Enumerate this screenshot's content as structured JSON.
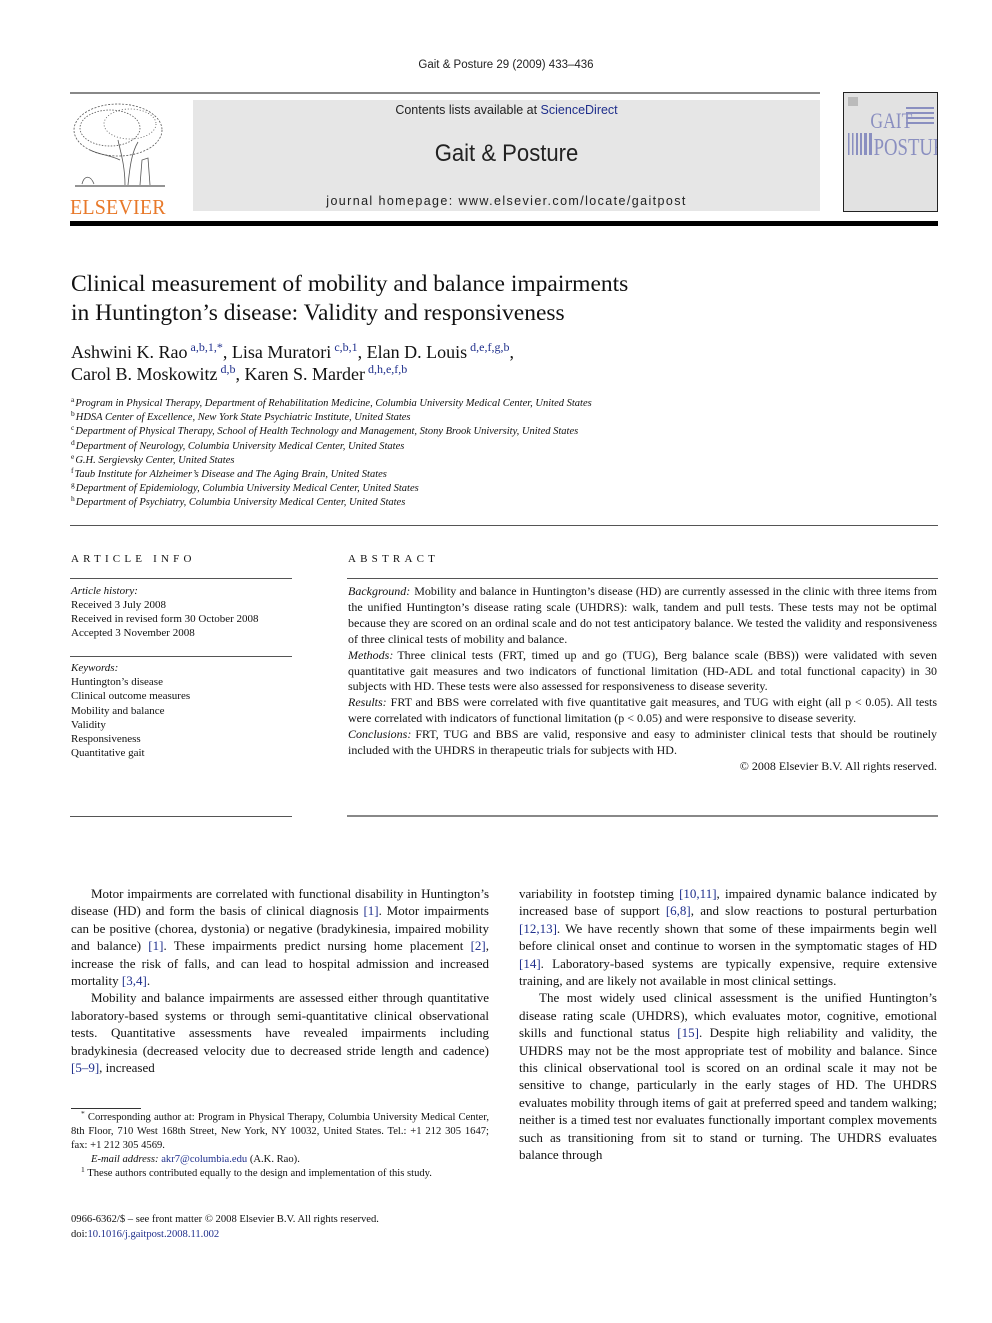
{
  "header": {
    "journal_ref": "Gait & Posture 29 (2009) 433–436",
    "contents_prefix": "Contents lists available at ",
    "contents_link": "ScienceDirect",
    "journal_name": "Gait & Posture",
    "homepage": "journal homepage: www.elsevier.com/locate/gaitpost",
    "publisher_logo_text": "ELSEVIER",
    "cover_title_line1": "GAIT",
    "cover_title_line2": "POSTURE",
    "colors": {
      "publisher_orange": "#e8792a",
      "link_blue": "#1f2f8c",
      "banner_gray": "#e6e6e6"
    }
  },
  "article": {
    "title_line1": "Clinical measurement of mobility and balance impairments",
    "title_line2": "in Huntington’s disease: Validity and responsiveness",
    "authors": [
      {
        "name": "Ashwini K. Rao",
        "sup": "a,b,1,*",
        "sep": ", "
      },
      {
        "name": "Lisa Muratori",
        "sup": "c,b,1",
        "sep": ", "
      },
      {
        "name": "Elan D. Louis",
        "sup": "d,e,f,g,b",
        "sep": ","
      },
      {
        "name": "Carol B. Moskowitz",
        "sup": "d,b",
        "sep": ", "
      },
      {
        "name": "Karen S. Marder",
        "sup": "d,h,e,f,b",
        "sep": ""
      }
    ],
    "affiliations": [
      {
        "key": "a",
        "text": "Program in Physical Therapy, Department of Rehabilitation Medicine, Columbia University Medical Center, United States"
      },
      {
        "key": "b",
        "text": "HDSA Center of Excellence, New York State Psychiatric Institute, United States"
      },
      {
        "key": "c",
        "text": "Department of Physical Therapy, School of Health Technology and Management, Stony Brook University, United States"
      },
      {
        "key": "d",
        "text": "Department of Neurology, Columbia University Medical Center, United States"
      },
      {
        "key": "e",
        "text": "G.H. Sergievsky Center, United States"
      },
      {
        "key": "f",
        "text": "Taub Institute for Alzheimer’s Disease and The Aging Brain, United States"
      },
      {
        "key": "g",
        "text": "Department of Epidemiology, Columbia University Medical Center, United States"
      },
      {
        "key": "h",
        "text": "Department of Psychiatry, Columbia University Medical Center, United States"
      }
    ]
  },
  "article_info": {
    "heading": "ARTICLE INFO",
    "history_label": "Article history:",
    "history": [
      "Received 3 July 2008",
      "Received in revised form 30 October 2008",
      "Accepted 3 November 2008"
    ],
    "keywords_label": "Keywords:",
    "keywords": [
      "Huntington’s disease",
      "Clinical outcome measures",
      "Mobility and balance",
      "Validity",
      "Responsiveness",
      "Quantitative gait"
    ]
  },
  "abstract": {
    "heading": "ABSTRACT",
    "sections": [
      {
        "label": "Background:",
        "text": "Mobility and balance in Huntington’s disease (HD) are currently assessed in the clinic with three items from the unified Huntington’s disease rating scale (UHDRS): walk, tandem and pull tests. These tests may not be optimal because they are scored on an ordinal scale and do not test anticipatory balance. We tested the validity and responsiveness of three clinical tests of mobility and balance."
      },
      {
        "label": "Methods:",
        "text": "Three clinical tests (FRT, timed up and go (TUG), Berg balance scale (BBS)) were validated with seven quantitative gait measures and two indicators of functional limitation (HD-ADL and total functional capacity) in 30 subjects with HD. These tests were also assessed for responsiveness to disease severity."
      },
      {
        "label": "Results:",
        "text": "FRT and BBS were correlated with five quantitative gait measures, and TUG with eight (all p < 0.05). All tests were correlated with indicators of functional limitation (p < 0.05) and were responsive to disease severity."
      },
      {
        "label": "Conclusions:",
        "text": "FRT, TUG and BBS are valid, responsive and easy to administer clinical tests that should be routinely included with the UHDRS in therapeutic trials for subjects with HD."
      }
    ],
    "copyright": "© 2008 Elsevier B.V. All rights reserved."
  },
  "body": {
    "left": [
      [
        {
          "t": "Motor impairments are correlated with functional disability in Huntington’s disease (HD) and form the basis of clinical diagnosis "
        },
        {
          "ref": "[1]"
        },
        {
          "t": ". Motor impairments can be positive (chorea, dystonia) or negative (bradykinesia, impaired mobility and balance) "
        },
        {
          "ref": "[1]"
        },
        {
          "t": ". These impairments predict nursing home placement "
        },
        {
          "ref": "[2]"
        },
        {
          "t": ", increase the risk of falls, and can lead to hospital admission and increased mortality "
        },
        {
          "ref": "[3,4]"
        },
        {
          "t": "."
        }
      ],
      [
        {
          "t": "Mobility and balance impairments are assessed either through quantitative laboratory-based systems or through semi-quantitative clinical observational tests. Quantitative assessments have revealed impairments including bradykinesia (decreased velocity due to decreased stride length and cadence) "
        },
        {
          "ref": "[5–9]"
        },
        {
          "t": ", increased"
        }
      ]
    ],
    "right": [
      [
        {
          "t": "variability in footstep timing "
        },
        {
          "ref": "[10,11]"
        },
        {
          "t": ", impaired dynamic balance indicated by increased base of support "
        },
        {
          "ref": "[6,8]"
        },
        {
          "t": ", and slow reactions to postural perturbation "
        },
        {
          "ref": "[12,13]"
        },
        {
          "t": ". We have recently shown that some of these impairments begin well before clinical onset and continue to worsen in the symptomatic stages of HD "
        },
        {
          "ref": "[14]"
        },
        {
          "t": ". Laboratory-based systems are typically expensive, require extensive training, and are likely not available in most clinical settings."
        }
      ],
      [
        {
          "t": "The most widely used clinical assessment is the unified Huntington’s disease rating scale (UHDRS), which evaluates motor, cognitive, emotional skills and functional status "
        },
        {
          "ref": "[15]"
        },
        {
          "t": ". Despite high reliability and validity, the UHDRS may not be the most appropriate test of mobility and balance. Since this clinical observational tool is scored on an ordinal scale it may not be sensitive to change, particularly in the early stages of HD. The UHDRS evaluates mobility through items of gait at preferred speed and tandem walking; neither is a timed test nor evaluates functionally important complex movements such as transitioning from sit to stand or turning. The UHDRS evaluates balance through"
        }
      ]
    ]
  },
  "footnotes": {
    "corresponding_mark": "*",
    "corresponding": "Corresponding author at: Program in Physical Therapy, Columbia University Medical Center, 8th Floor, 710 West 168th Street, New York, NY 10032, United States. Tel.: +1 212 305 1647; fax: +1 212 305 4569.",
    "email_label": "E-mail address:",
    "email": "akr7@columbia.edu",
    "email_suffix": " (A.K. Rao).",
    "equal_mark": "1",
    "equal": "These authors contributed equally to the design and implementation of this study.",
    "front_matter": "0966-6362/$ – see front matter © 2008 Elsevier B.V. All rights reserved.",
    "doi_prefix": "doi:",
    "doi": "10.1016/j.gaitpost.2008.11.002"
  }
}
